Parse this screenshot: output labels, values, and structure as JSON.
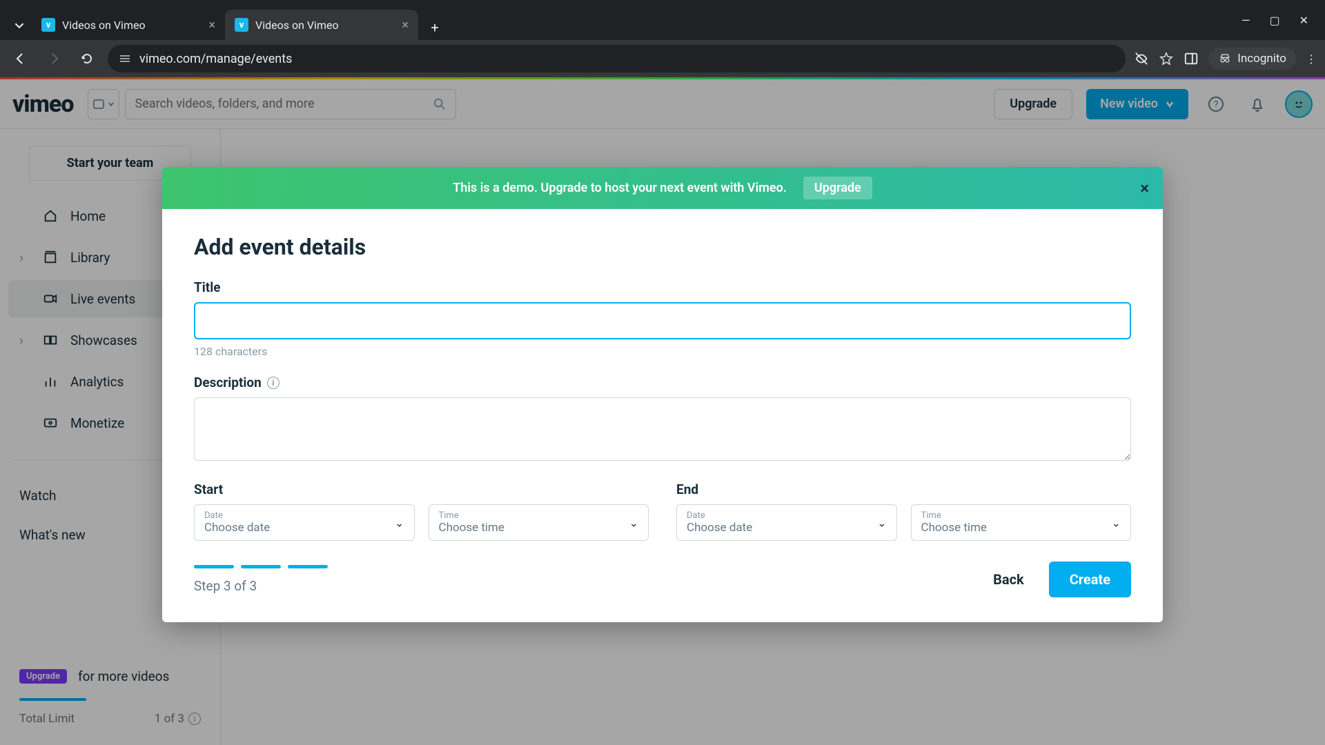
{
  "browser": {
    "tabs": [
      {
        "title": "Videos on Vimeo"
      },
      {
        "title": "Videos on Vimeo"
      }
    ],
    "url": "vimeo.com/manage/events",
    "incognito_label": "Incognito"
  },
  "header": {
    "logo": "vimeo",
    "search_placeholder": "Search videos, folders, and more",
    "upgrade": "Upgrade",
    "new_video": "New video"
  },
  "sidebar": {
    "team_button": "Start your team",
    "items": [
      {
        "label": "Home"
      },
      {
        "label": "Library"
      },
      {
        "label": "Live events"
      },
      {
        "label": "Showcases"
      },
      {
        "label": "Analytics"
      },
      {
        "label": "Monetize"
      }
    ],
    "watch": "Watch",
    "whats_new": "What's new",
    "upgrade_pill": "Upgrade",
    "upgrade_text": "for more videos",
    "limit_label": "Total Limit",
    "limit_value": "1 of 3"
  },
  "modal": {
    "banner_text": "This is a demo. Upgrade to host your next event with Vimeo.",
    "banner_upgrade": "Upgrade",
    "title": "Add event details",
    "title_label": "Title",
    "title_value": "",
    "char_hint": "128 characters",
    "desc_label": "Description",
    "start_label": "Start",
    "end_label": "End",
    "date_caption": "Date",
    "date_placeholder": "Choose date",
    "time_caption": "Time",
    "time_placeholder": "Choose time",
    "step_text": "Step 3 of 3",
    "back": "Back",
    "create": "Create"
  }
}
